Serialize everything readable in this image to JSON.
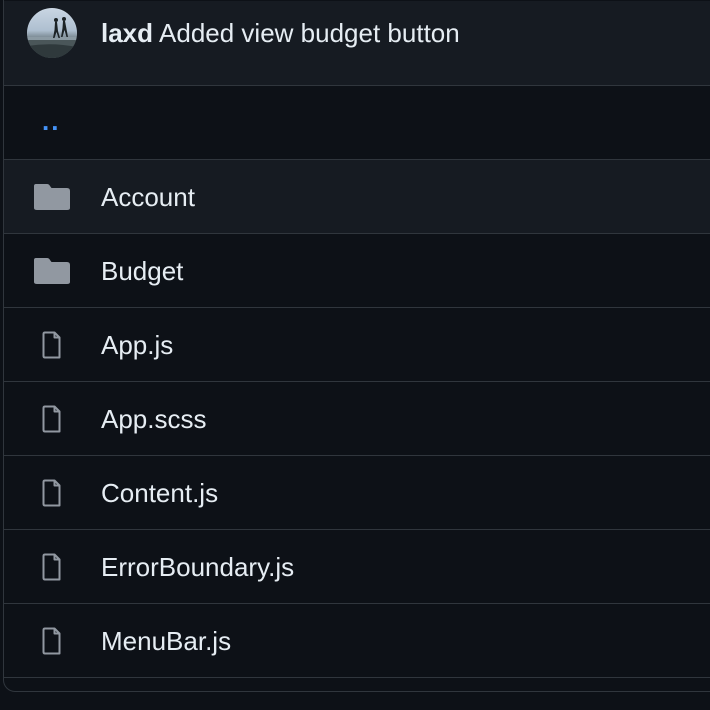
{
  "commit": {
    "author": "laxd",
    "message": "Added view budget button"
  },
  "parent": {
    "label": ".."
  },
  "files": [
    {
      "name": "Account",
      "type": "folder",
      "icon": "folder-icon"
    },
    {
      "name": "Budget",
      "type": "folder",
      "icon": "folder-icon"
    },
    {
      "name": "App.js",
      "type": "file",
      "icon": "file-icon"
    },
    {
      "name": "App.scss",
      "type": "file",
      "icon": "file-icon"
    },
    {
      "name": "Content.js",
      "type": "file",
      "icon": "file-icon"
    },
    {
      "name": "ErrorBoundary.js",
      "type": "file",
      "icon": "file-icon"
    },
    {
      "name": "MenuBar.js",
      "type": "file",
      "icon": "file-icon"
    }
  ],
  "colors": {
    "background": "#0d1117",
    "header": "#161b22",
    "border": "#30363d",
    "text": "#e6edf3",
    "icon": "#9198a1",
    "link": "#4493f8"
  }
}
